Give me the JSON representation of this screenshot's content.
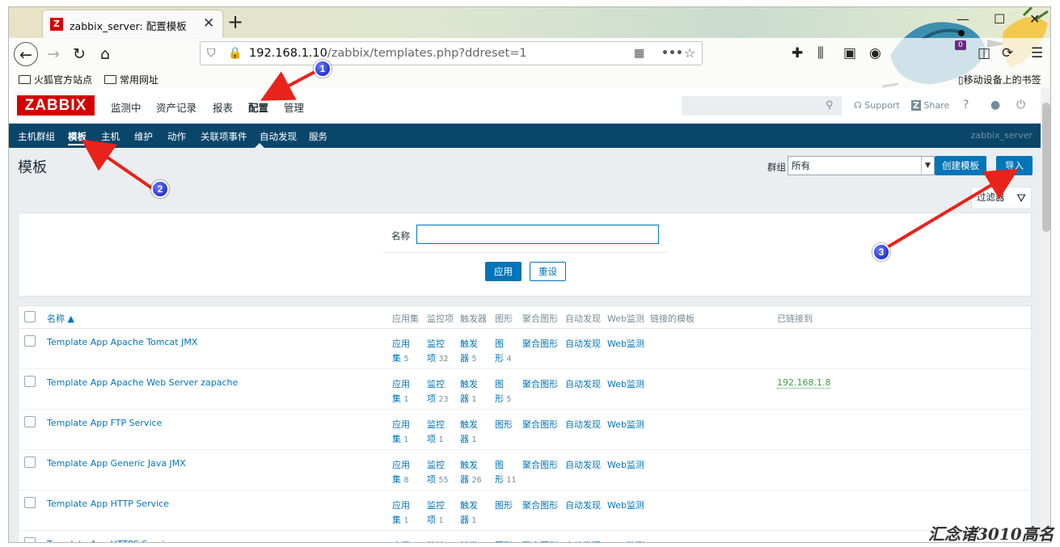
{
  "browser": {
    "tab_title": "zabbix_server: 配置模板",
    "tab_favicon": "Z",
    "new_tab": "+",
    "url_prefix": "192.168.1.10",
    "url_rest": "/zabbix/templates.php?ddreset=1",
    "toolbar_badge": "0",
    "bookmarks": [
      "火狐官方站点",
      "常用网址"
    ],
    "mobile_bookmarks": "移动设备上的书签"
  },
  "header": {
    "logo": "ZABBIX",
    "menu": [
      "监测中",
      "资产记录",
      "报表",
      "配置",
      "管理"
    ],
    "selected_menu": "配置",
    "support": "Support",
    "share": "Share",
    "help": "?"
  },
  "submenu": {
    "items": [
      "主机群组",
      "模板",
      "主机",
      "维护",
      "动作",
      "关联项事件",
      "自动发现",
      "服务"
    ],
    "selected": "模板",
    "server_name": "zabbix_server"
  },
  "page": {
    "title": "模板",
    "group_label": "群组",
    "group_value": "所有",
    "create_button": "创建模板",
    "import_button": "导入",
    "filter_tab": "过滤器"
  },
  "filter": {
    "name_label": "名称",
    "name_value": "",
    "apply": "应用",
    "reset": "重设"
  },
  "table": {
    "headers": [
      "名称 ▲",
      "应用集",
      "监控项",
      "触发器",
      "图形",
      "聚合图形",
      "自动发现",
      "Web监测",
      "链接的模板",
      "已链接到"
    ],
    "rows": [
      {
        "name": "Template App Apache Tomcat JMX",
        "apps": "5",
        "items": "32",
        "triggers": "5",
        "graphs": "4",
        "linked": ""
      },
      {
        "name": "Template App Apache Web Server zapache",
        "apps": "1",
        "items": "23",
        "triggers": "1",
        "graphs": "5",
        "linked": "192.168.1.8"
      },
      {
        "name": "Template App FTP Service",
        "apps": "1",
        "items": "1",
        "triggers": "1",
        "graphs": "",
        "linked": ""
      },
      {
        "name": "Template App Generic Java JMX",
        "apps": "8",
        "items": "55",
        "triggers": "26",
        "graphs": "11",
        "linked": ""
      },
      {
        "name": "Template App HTTP Service",
        "apps": "1",
        "items": "1",
        "triggers": "1",
        "graphs": "",
        "linked": ""
      },
      {
        "name": "Template App HTTPS Service",
        "apps": "",
        "items": "",
        "triggers": "",
        "graphs": "",
        "linked": ""
      }
    ],
    "cell_words": {
      "apps": [
        "应用",
        "集"
      ],
      "items": [
        "监控",
        "项"
      ],
      "triggers": [
        "触发",
        "器"
      ],
      "graphs": [
        "图",
        "形"
      ],
      "graphs_single": "图形",
      "screens": "聚合图形",
      "discovery": "自动发现",
      "web": "Web监测"
    }
  },
  "annotations": [
    "1",
    "2",
    "3"
  ],
  "watermark": "汇念诸3010高名",
  "colors": {
    "zabbix_red": "#d40000",
    "submenu_bg": "#0a466a",
    "link_blue": "#0275b8",
    "linked_green": "#429e47",
    "arrow_red": "#e8231b"
  }
}
